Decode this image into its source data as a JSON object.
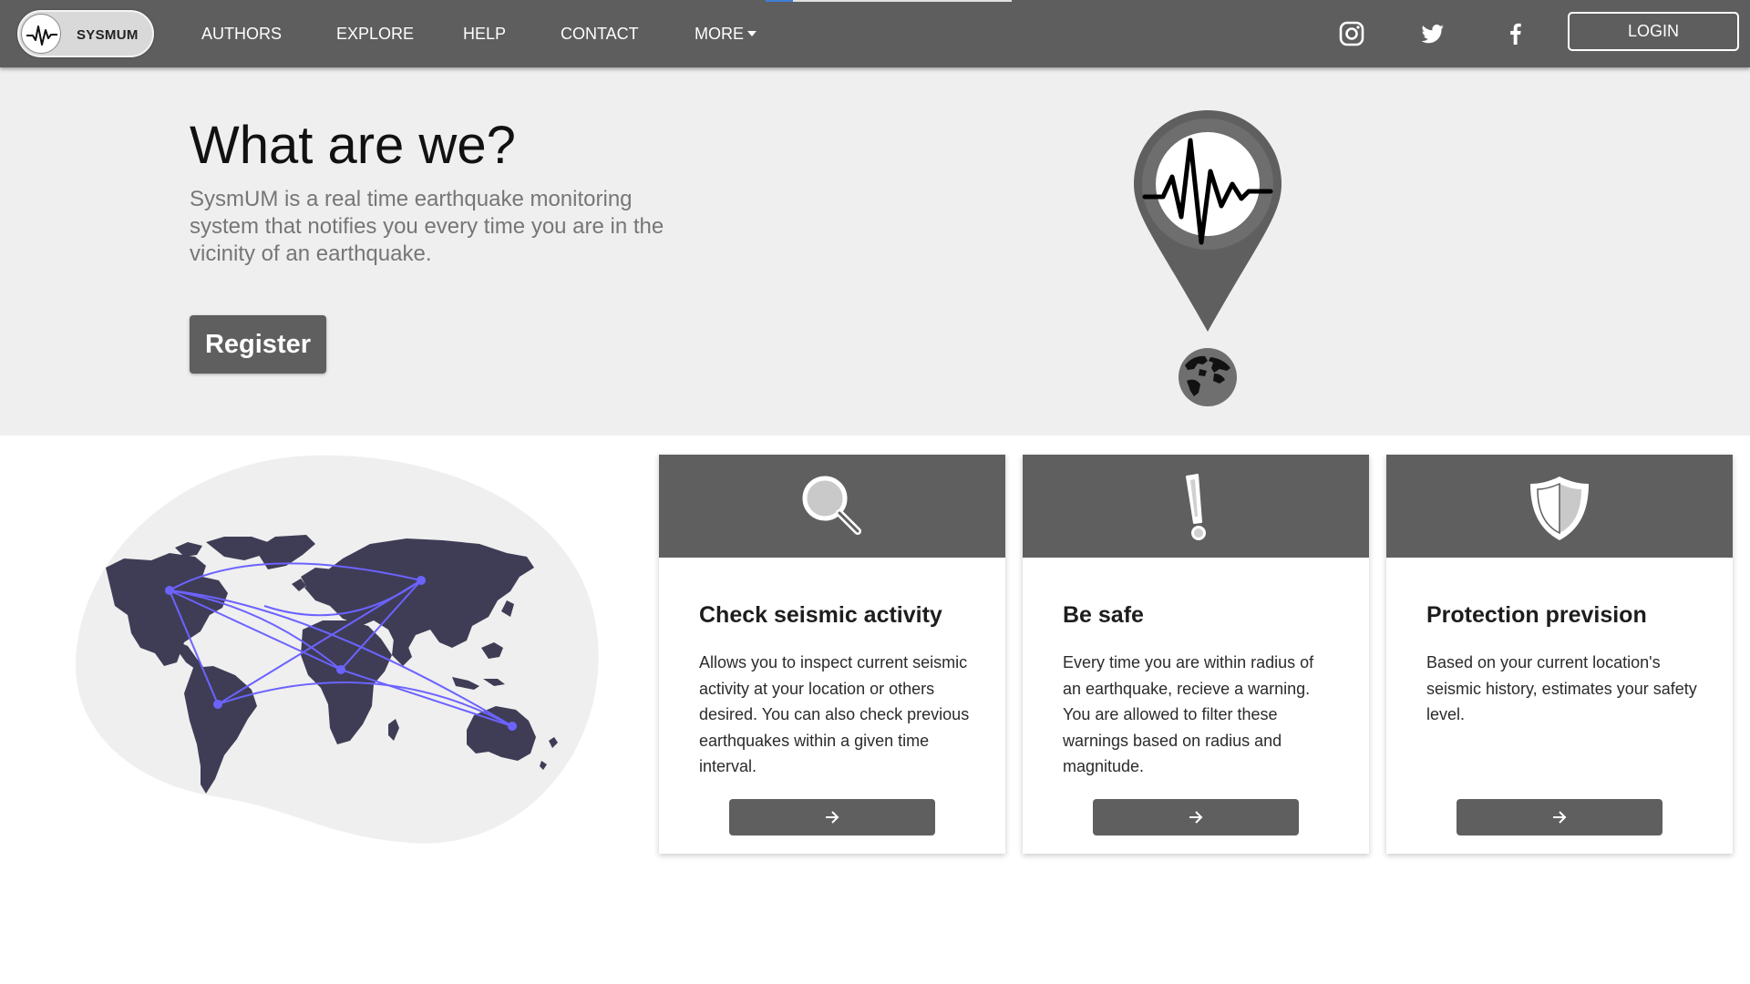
{
  "navbar": {
    "brand": "SYSMUM",
    "links": [
      {
        "label": "AUTHORS"
      },
      {
        "label": "EXPLORE"
      },
      {
        "label": "HELP"
      },
      {
        "label": "CONTACT"
      },
      {
        "label": "MORE"
      }
    ],
    "social_icons": [
      "instagram-icon",
      "twitter-icon",
      "facebook-icon"
    ],
    "login_label": "LOGIN"
  },
  "hero": {
    "title": "What are we?",
    "description": "SysmUM is a real time earthquake monitoring system that notifies you every time you are in the vicinity of an earthquake.",
    "register_label": "Register",
    "illustration": "seismic-pin-globe"
  },
  "features": [
    {
      "icon": "magnifier-icon",
      "title": "Check seismic activity",
      "text": "Allows you to inspect current seismic activity at your location or others desired. You can also check previous earthquakes within a given time interval.",
      "button_icon": "arrow-right-icon"
    },
    {
      "icon": "exclamation-icon",
      "title": "Be safe",
      "text": "Every time you are within radius of an earthquake, recieve a warning. You are allowed to filter these warnings based on radius and magnitude.",
      "button_icon": "arrow-right-icon"
    },
    {
      "icon": "shield-icon",
      "title": "Protection prevision",
      "text": "Based on your current location's seismic history, estimates your safety level.",
      "button_icon": "arrow-right-icon"
    }
  ],
  "colors": {
    "navbar": "#5e5e5e",
    "hero_bg": "#efefef",
    "button": "#5f5f5f",
    "map_land": "#3f3d56",
    "map_lines": "#6c63ff"
  }
}
